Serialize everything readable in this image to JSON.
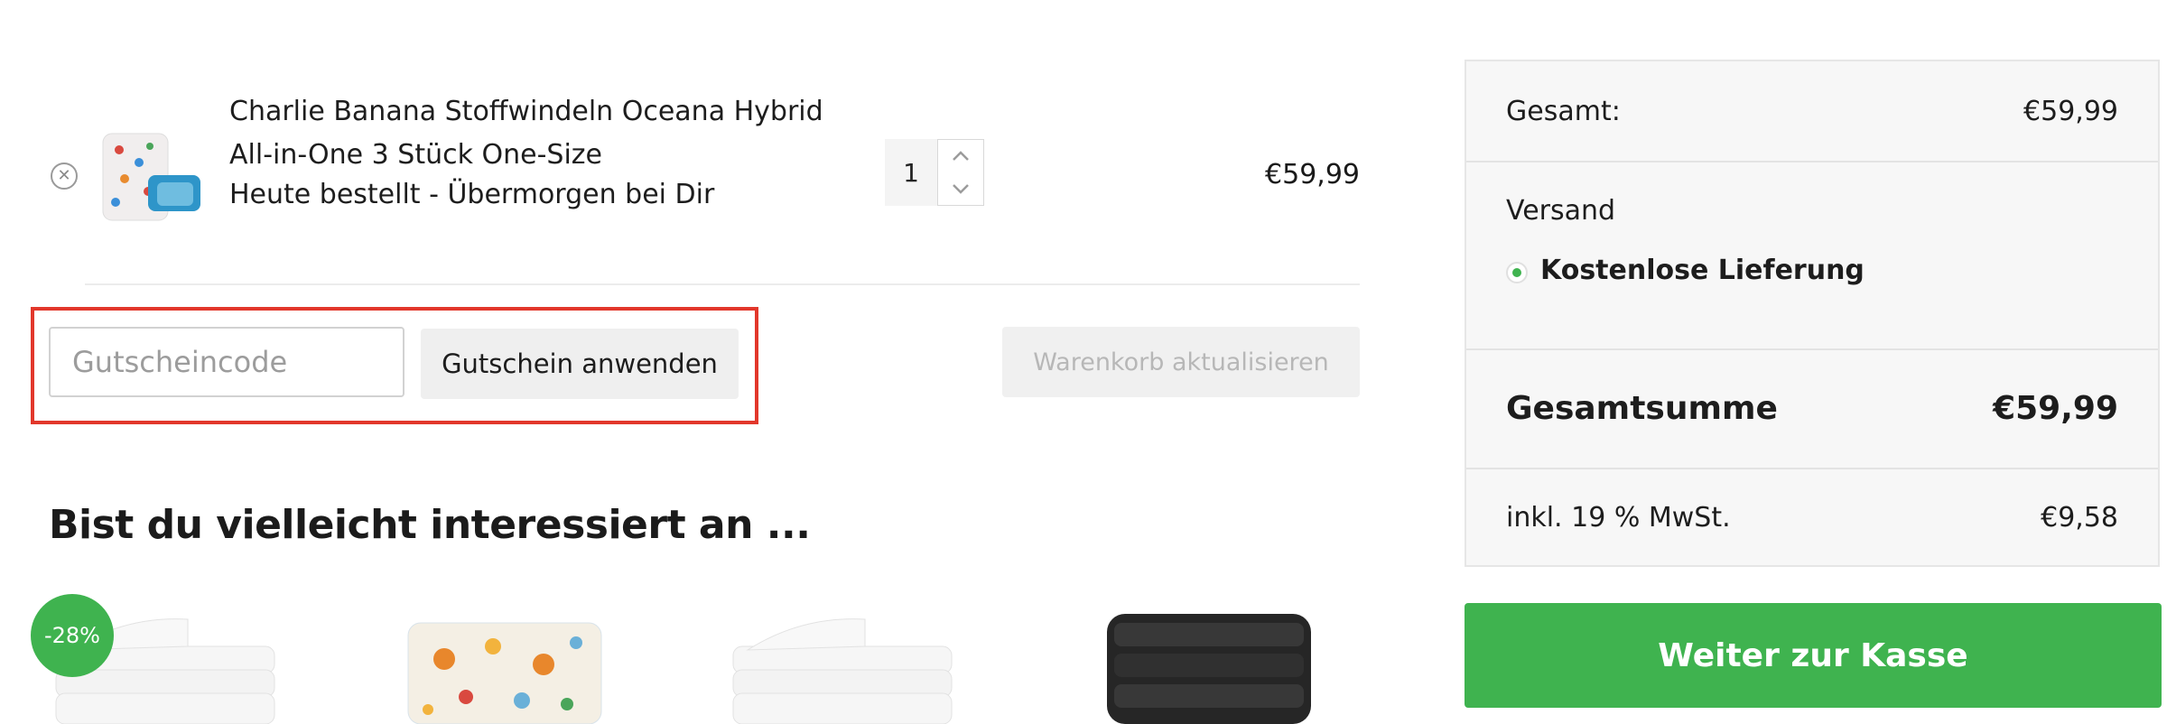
{
  "cart": {
    "item": {
      "name": "Charlie Banana Stoffwindeln Oceana Hybrid All-in-One 3 Stück One-Size",
      "delivery": "Heute bestellt - Übermorgen bei Dir",
      "quantity": "1",
      "price": "€59,99"
    },
    "coupon_placeholder": "Gutscheincode",
    "apply_label": "Gutschein anwenden",
    "update_label": "Warenkorb aktualisieren"
  },
  "related": {
    "heading": "Bist du vielleicht interessiert an ...",
    "badge": "-28%"
  },
  "summary": {
    "subtotal_label": "Gesamt:",
    "subtotal_value": "€59,99",
    "shipping_label": "Versand",
    "shipping_option": "Kostenlose Lieferung",
    "total_label": "Gesamtsumme",
    "total_value": "€59,99",
    "tax_label": "inkl. 19 % MwSt.",
    "tax_value": "€9,58"
  },
  "checkout_label": "Weiter zur Kasse",
  "colors": {
    "accent": "#3fb34f",
    "highlight": "#e2372b"
  }
}
